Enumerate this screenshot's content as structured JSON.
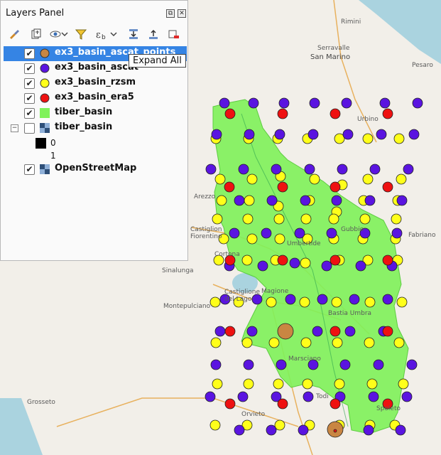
{
  "panel": {
    "title": "Layers Panel",
    "float_label": "⧉",
    "close_label": "✕",
    "toolbar_icons": [
      "style-brush-icon",
      "add-group-icon",
      "visibility-eye-icon",
      "filter-funnel-icon",
      "filter-expression-icon",
      "dropdown-arrow-icon",
      "expand-all-icon",
      "collapse-all-icon",
      "remove-layer-icon"
    ]
  },
  "layers": [
    {
      "name": "ex3_basin_ascat_points",
      "checked": true,
      "symbol": "circle",
      "color": "#c98642",
      "selected": true,
      "indent": false
    },
    {
      "name": "ex3_basin_ascat",
      "checked": true,
      "symbol": "circle",
      "color": "#5a14e0",
      "selected": false,
      "indent": false
    },
    {
      "name": "ex3_basin_rzsm",
      "checked": true,
      "symbol": "circle",
      "color": "#ffff1a",
      "selected": false,
      "indent": false
    },
    {
      "name": "ex3_basin_era5",
      "checked": true,
      "symbol": "circle",
      "color": "#ee1111",
      "selected": false,
      "indent": false
    },
    {
      "name": "tiber_basin",
      "checked": true,
      "symbol": "fill",
      "color": "#7ff25a",
      "selected": false,
      "indent": false
    },
    {
      "name": "tiber_basin",
      "checked": false,
      "symbol": "raster",
      "color": "#2e4f78",
      "selected": false,
      "indent": false,
      "expanded": true
    },
    {
      "name": "OpenStreetMap",
      "checked": true,
      "symbol": "raster",
      "color": "#2e4f78",
      "selected": false,
      "indent": false
    }
  ],
  "raster_legend": [
    {
      "label": "0",
      "color": "#000000"
    },
    {
      "label": "1",
      "color": ""
    }
  ],
  "tooltip": "Expand All",
  "map_labels": [
    {
      "text": "Rimini"
    },
    {
      "text": "Serravalle"
    },
    {
      "text": "San Marino"
    },
    {
      "text": "Pesaro"
    },
    {
      "text": "Urbino"
    },
    {
      "text": "Arezzo"
    },
    {
      "text": "Castiglion Fiorentino"
    },
    {
      "text": "Cortona"
    },
    {
      "text": "Sinalunga"
    },
    {
      "text": "Castiglione del Lago"
    },
    {
      "text": "Magione"
    },
    {
      "text": "Montepulciano"
    },
    {
      "text": "Fabriano"
    },
    {
      "text": "Umbertide"
    },
    {
      "text": "Gubbio"
    },
    {
      "text": "Bastia Umbra"
    },
    {
      "text": "Marsciano"
    },
    {
      "text": "Spoleto"
    },
    {
      "text": "Grosseto"
    },
    {
      "text": "Orvieto"
    },
    {
      "text": "Todi"
    }
  ],
  "map_colors": {
    "background": "#f2efe9",
    "water": "#aad3df",
    "basin": "#7ff25a",
    "basin_stroke": "#4fc830"
  }
}
